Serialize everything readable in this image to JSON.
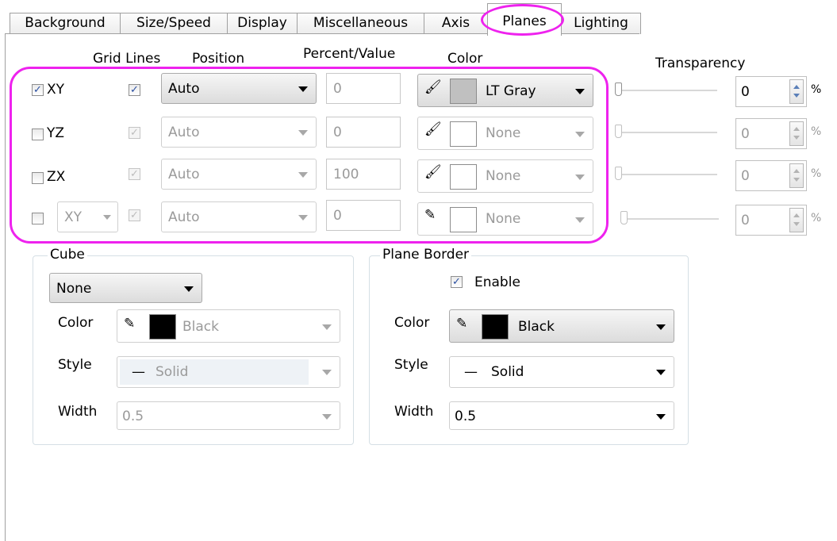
{
  "tabs": [
    "Background",
    "Size/Speed",
    "Display",
    "Miscellaneous",
    "Axis",
    "Planes",
    "Lighting"
  ],
  "active_tab": "Planes",
  "headers": {
    "grid_lines": "Grid Lines",
    "position": "Position",
    "percent_value": "Percent/Value",
    "color": "Color",
    "transparency": "Transparency"
  },
  "planes": [
    {
      "label": "XY",
      "checked": true,
      "grid_checked": true,
      "position": "Auto",
      "value": "0",
      "color_name": "LT Gray",
      "color_hex": "#c0c0c0",
      "color_icon": "fill-bucket-icon",
      "transparency": "0",
      "percent": "%",
      "enabled": true
    },
    {
      "label": "YZ",
      "checked": false,
      "grid_checked": true,
      "position": "Auto",
      "value": "0",
      "color_name": "None",
      "color_hex": "#ffffff",
      "color_icon": "fill-bucket-icon",
      "transparency": "0",
      "percent": "%",
      "enabled": false
    },
    {
      "label": "ZX",
      "checked": false,
      "grid_checked": true,
      "position": "Auto",
      "value": "100",
      "color_name": "None",
      "color_hex": "#ffffff",
      "color_icon": "fill-bucket-icon",
      "transparency": "0",
      "percent": "%",
      "enabled": false
    },
    {
      "label": "XY",
      "checked": false,
      "grid_checked": true,
      "position": "Auto",
      "value": "0",
      "color_name": "None",
      "color_hex": "#ffffff",
      "color_icon": "pencil-icon",
      "transparency": "0",
      "percent": "%",
      "enabled": false,
      "label_is_combo": true
    }
  ],
  "cube": {
    "title": "Cube",
    "type": "None",
    "color_label": "Color",
    "color_value": "Black",
    "color_hex": "#000000",
    "style_label": "Style",
    "style_value": "Solid",
    "width_label": "Width",
    "width_value": "0.5"
  },
  "plane_border": {
    "title": "Plane Border",
    "enable_label": "Enable",
    "enabled": true,
    "color_label": "Color",
    "color_value": "Black",
    "color_hex": "#000000",
    "style_label": "Style",
    "style_value": "Solid",
    "width_label": "Width",
    "width_value": "0.5"
  },
  "style_glyph": "—",
  "check_glyph": "✓",
  "highlight_color": "#ee22ee"
}
